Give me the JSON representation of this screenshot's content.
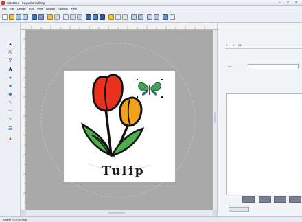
{
  "window": {
    "title": "StitchEra - Layout & Editing",
    "min_symbol": "–",
    "max_symbol": "□",
    "close_symbol": "×"
  },
  "menu": [
    "File",
    "Edit",
    "Design",
    "Font",
    "View",
    "Display",
    "Options",
    "Help"
  ],
  "canvas": {
    "design_text": "Tulip",
    "hoop": "round"
  },
  "right_panel": {
    "tabs": [
      "1",
      "2",
      "All"
    ],
    "field_label": "Text"
  },
  "status": {
    "text": "Ready. F1: For Help"
  },
  "icons": {
    "pointer": "pointer-icon",
    "zoom": "zoom-icon",
    "text": "text-tool-icon",
    "butterfly": "butterfly-embroidery-icon"
  },
  "colors": {
    "canvas_bg": "#a9a9a9",
    "hoop_area": "#ffffff",
    "tulip_red": "#e8321e",
    "tulip_orange": "#f2a11a",
    "leaf_green": "#4caf4a",
    "toolbar_bg": "#eceff4"
  }
}
